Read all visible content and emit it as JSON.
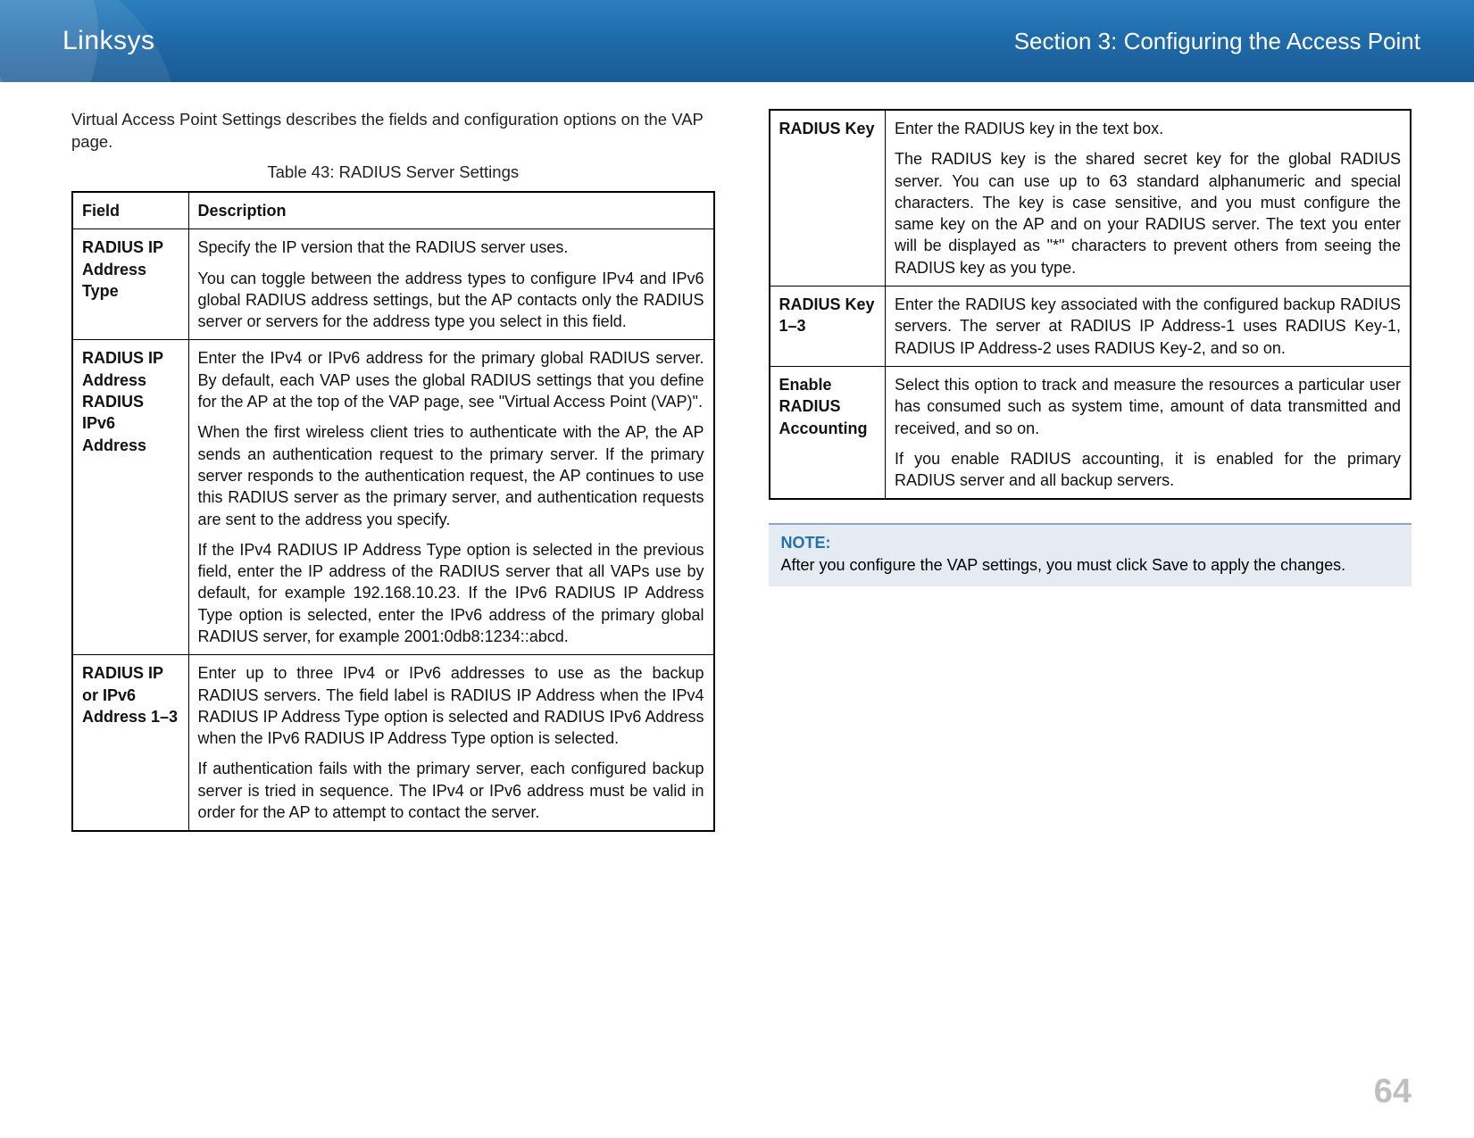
{
  "header": {
    "brand": "Linksys",
    "section": "Section 3:  Configuring the Access Point"
  },
  "intro": "Virtual Access Point Settings describes the fields and configuration options on the VAP page.",
  "table_caption": "Table 43: RADIUS Server Settings",
  "table_headers": {
    "field": "Field",
    "description": "Description"
  },
  "left_rows": [
    {
      "field": "RADIUS IP Address Type",
      "paras": [
        "Specify the IP version that the RADIUS server uses.",
        "You can toggle between the address types to configure IPv4 and IPv6 global RADIUS address settings, but the AP contacts only the RADIUS server or servers for the address type you select in this field."
      ]
    },
    {
      "field": "RADIUS IP Address RADIUS IPv6 Address",
      "paras": [
        "Enter the IPv4 or IPv6 address for the primary global RADIUS server. By default, each VAP uses the global RADIUS settings that you define for the AP at the top of the VAP page, see \"Virtual Access Point (VAP)\".",
        "When the first wireless client tries to authenticate with the AP, the AP sends an authentication request to the primary server. If the primary server responds to the authentication request, the AP continues to use this RADIUS server as the primary server, and authentication requests are sent to the address you specify.",
        "If the IPv4 RADIUS IP Address Type option is selected in the previous field, enter the IP address of the RADIUS server that all VAPs use by default, for example 192.168.10.23. If the IPv6 RADIUS IP Address Type option is selected, enter the IPv6 address of the primary global RADIUS server, for example 2001:0db8:1234::abcd."
      ]
    },
    {
      "field": "RADIUS IP or IPv6 Address 1–3",
      "paras": [
        "Enter up to three IPv4 or IPv6 addresses to use as the backup RADIUS servers. The field label is RADIUS IP Address when the IPv4 RADIUS IP Address Type option is selected and RADIUS IPv6 Address when the IPv6 RADIUS IP Address Type option is selected.",
        "If authentication fails with the primary server, each configured backup server is tried in sequence. The IPv4 or IPv6 address must be valid in order for the AP to attempt to contact the server."
      ]
    }
  ],
  "right_rows": [
    {
      "field": "RADIUS Key",
      "paras": [
        "Enter the RADIUS key in the text box.",
        "The RADIUS key is the shared secret key for the global RADIUS server. You can use up to 63 standard alphanumeric and special characters. The key is case sensitive, and you must configure the same key on the AP and on your RADIUS server. The text you enter will be displayed as \"*\" characters to prevent others from seeing the RADIUS key as you type."
      ]
    },
    {
      "field": "RADIUS Key 1–3",
      "paras": [
        "Enter the RADIUS key associated with the configured backup RADIUS servers. The server at RADIUS IP Address-1 uses RADIUS Key-1, RADIUS IP Address-2 uses RADIUS Key-2, and so on."
      ]
    },
    {
      "field": "Enable RADIUS Accounting",
      "paras": [
        "Select this option to track and measure the resources a particular user has consumed such as system time, amount of data transmitted and received, and so on.",
        "If you enable RADIUS accounting, it is enabled for the primary RADIUS server and all backup servers."
      ]
    }
  ],
  "note": {
    "label": "NOTE:",
    "text": "After you configure the VAP settings, you must click Save to apply the changes."
  },
  "page_number": "64"
}
